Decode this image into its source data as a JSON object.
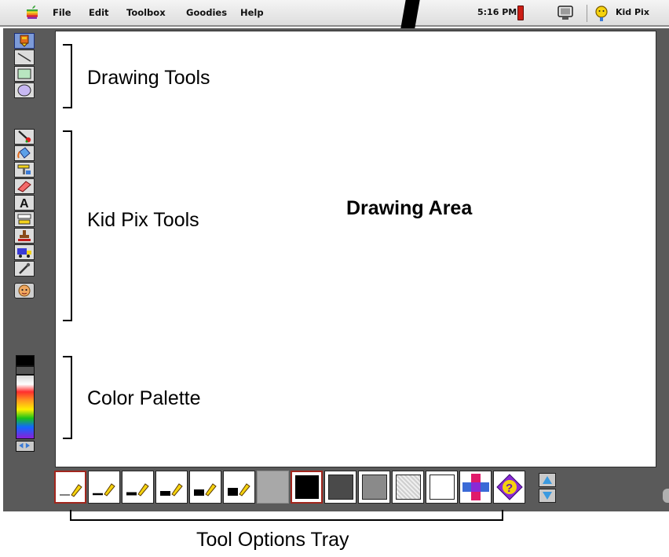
{
  "menu": {
    "items": [
      "File",
      "Edit",
      "Toolbox",
      "Goodies",
      "Help"
    ],
    "clock": "5:16 PM",
    "app_name": "Kid Pix"
  },
  "toolbox": {
    "drawing_tools": [
      "wacky-pencil-icon",
      "line-icon",
      "rectangle-icon",
      "oval-icon"
    ],
    "kid_pix_tools": [
      "paintbrush-icon",
      "paint-bucket-icon",
      "text-stamp-icon",
      "eraser-icon",
      "alphabet-text-icon",
      "moving-van-label-icon",
      "rubber-stamp-icon",
      "moving-van-icon",
      "eyedropper-icon",
      "undo-guy-icon"
    ],
    "selected": "wacky-pencil-icon"
  },
  "palette": {
    "colors": [
      "#000000",
      "#5a5a5a",
      "#b0b0b0",
      "#ffffff",
      "#ff2d2d",
      "#ff9a1f",
      "#ffee00",
      "#18c21a",
      "#1166ff",
      "#8b1fd6"
    ]
  },
  "tray": {
    "line_sizes": [
      "thinnest",
      "thin",
      "medium",
      "thick",
      "thicker",
      "thickest"
    ],
    "patterns": [
      "black",
      "dark-gray",
      "medium-gray",
      "light-gray",
      "white",
      "color-cross",
      "mystery"
    ],
    "selected_size": "thinnest",
    "selected_pattern": "black"
  },
  "annotations": {
    "drawing_tools": "Drawing Tools",
    "kid_pix_tools": "Kid Pix Tools",
    "color_palette": "Color Palette",
    "drawing_area": "Drawing Area",
    "tool_options_tray": "Tool Options Tray"
  },
  "colors": {
    "window_frame": "#5a5a5a",
    "selection_red": "#a1261d",
    "selected_tool_blue": "#7d9bd8"
  }
}
